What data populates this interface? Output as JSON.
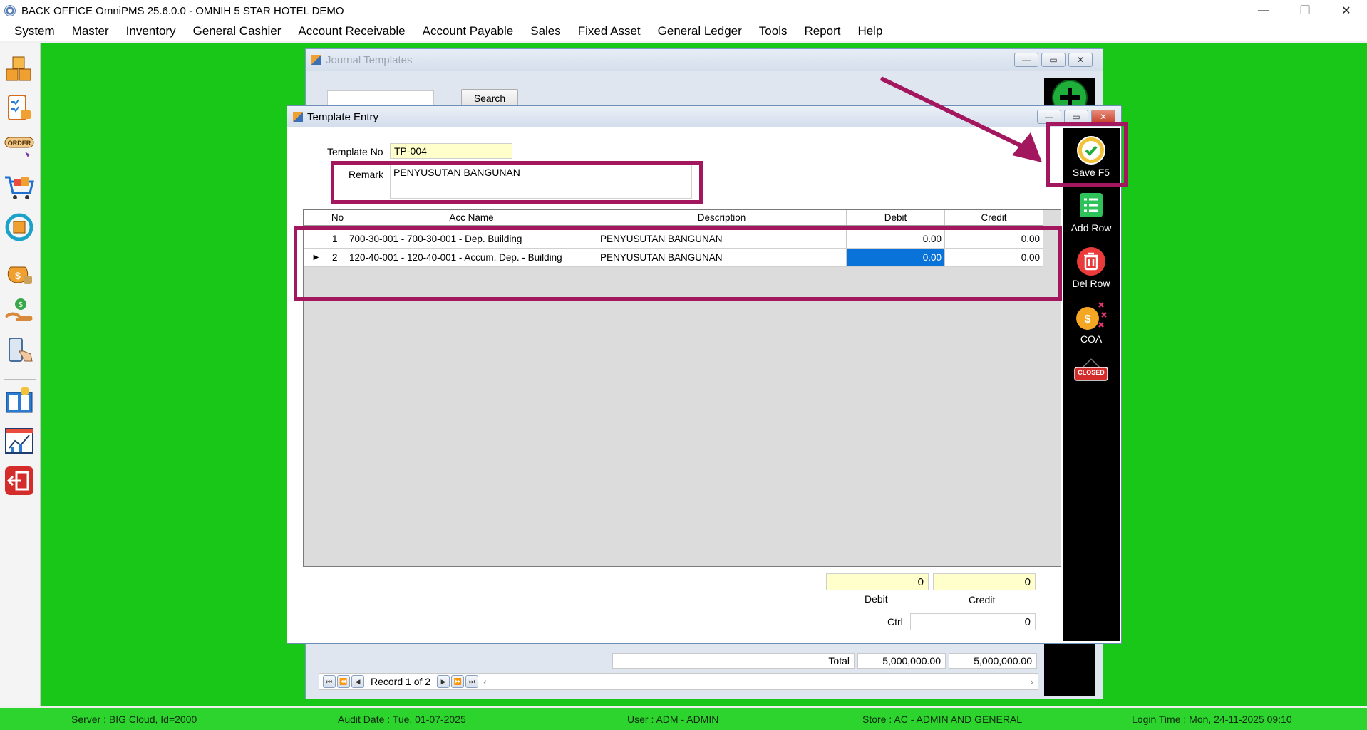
{
  "window": {
    "title": "BACK OFFICE OmniPMS 25.6.0.0 - OMNIH 5 STAR HOTEL DEMO",
    "controls": {
      "minimize": "—",
      "restore": "❐",
      "close": "✕"
    }
  },
  "menu": [
    "System",
    "Master",
    "Inventory",
    "General Cashier",
    "Account Receivable",
    "Account Payable",
    "Sales",
    "Fixed Asset",
    "General Ledger",
    "Tools",
    "Report",
    "Help"
  ],
  "journal_templates": {
    "title": "Journal Templates",
    "search_value": "",
    "search_button": "Search",
    "total_label": "Total",
    "total_debit": "5,000,000.00",
    "total_credit": "5,000,000.00",
    "record_label": "Record 1 of 2"
  },
  "template_entry": {
    "title": "Template Entry",
    "template_no_label": "Template No",
    "template_no": "TP-004",
    "remark_label": "Remark",
    "remark": "PENYUSUTAN BANGUNAN",
    "grid": {
      "columns": [
        "No",
        "Acc Name",
        "Description",
        "Debit",
        "Credit"
      ],
      "rows": [
        {
          "no": "1",
          "acc_name": "700-30-001 - 700-30-001 - Dep. Building",
          "description": "PENYUSUTAN BANGUNAN",
          "debit": "0.00",
          "credit": "0.00"
        },
        {
          "no": "2",
          "acc_name": "120-40-001 - 120-40-001 - Accum. Dep. - Building",
          "description": "PENYUSUTAN BANGUNAN",
          "debit": "0.00",
          "credit": "0.00"
        }
      ]
    },
    "totals": {
      "debit_value": "0",
      "credit_value": "0",
      "debit_label": "Debit",
      "credit_label": "Credit",
      "ctrl_label": "Ctrl",
      "ctrl_value": "0"
    },
    "actions": {
      "save": "Save F5",
      "add_row": "Add Row",
      "del_row": "Del Row",
      "coa": "COA",
      "closed": "CLOSED"
    }
  },
  "status": {
    "server": "Server : BIG Cloud, Id=2000",
    "audit_date": "Audit Date : Tue, 01-07-2025",
    "user": "User : ADM - ADMIN",
    "store": "Store : AC - ADMIN AND GENERAL",
    "login_time": "Login Time : Mon, 24-11-2025 09:10"
  },
  "colors": {
    "desktop": "#18c718",
    "annotation": "#a3175e",
    "selected_cell": "#0a73d9",
    "input_yellow": "#ffffcc"
  },
  "icons": [
    "boxes-icon",
    "clipboard-lock-icon",
    "order-icon",
    "shopping-cart-icon",
    "refresh-box-icon",
    "money-bags-icon",
    "hand-money-icon",
    "phone-touch-icon",
    "ledger-book-icon",
    "chart-report-icon",
    "logout-icon"
  ]
}
